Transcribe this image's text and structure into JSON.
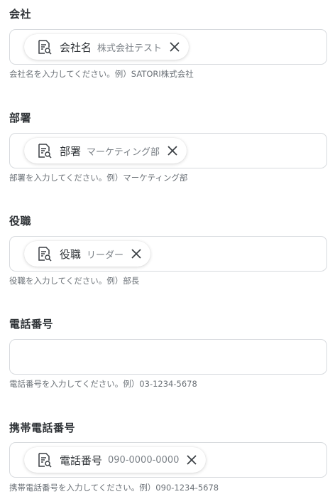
{
  "fields": [
    {
      "label": "会社",
      "chip": {
        "name": "会社名",
        "sample": "株式会社テスト"
      },
      "help": "会社名を入力してください。例）SATORI株式会社"
    },
    {
      "label": "部署",
      "chip": {
        "name": "部署",
        "sample": "マーケティング部"
      },
      "help": "部署を入力してください。例）マーケティング部"
    },
    {
      "label": "役職",
      "chip": {
        "name": "役職",
        "sample": "リーダー"
      },
      "help": "役職を入力してください。例）部長"
    },
    {
      "label": "電話番号",
      "chip": null,
      "help": "電話番号を入力してください。例）03-1234-5678"
    },
    {
      "label": "携帯電話番号",
      "chip": {
        "name": "電話番号",
        "sample": "090-0000-0000"
      },
      "help": "携帯電話番号を入力してください。例）090-1234-5678"
    }
  ],
  "icons": {
    "chip": "document-search-icon",
    "remove": "close-icon"
  },
  "colors": {
    "border": "#d7dade",
    "text": "#2f3337",
    "muted": "#7b8187"
  }
}
